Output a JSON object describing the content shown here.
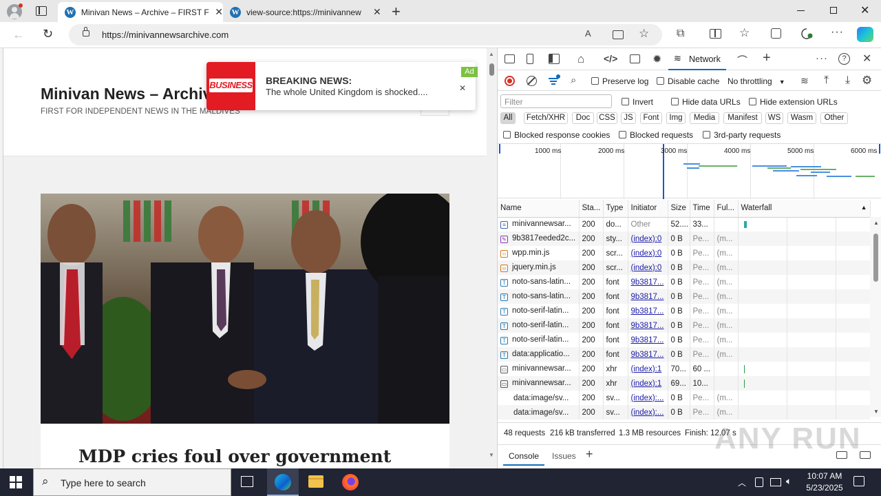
{
  "browser": {
    "tabs": [
      {
        "title": "Minivan News – Archive – FIRST F",
        "active": true
      },
      {
        "title": "view-source:https://minivannew",
        "active": false
      }
    ],
    "url": "https://minivannewsarchive.com"
  },
  "page": {
    "site_title": "Minivan News – Archiv",
    "tagline": "FIRST FOR INDEPENDENT NEWS IN THE MALDIVES",
    "headline": "MDP cries foul over government"
  },
  "notification": {
    "logo_text": "BUSINESS",
    "title": "BREAKING NEWS:",
    "body": "The whole United Kingdom is shocked....",
    "ad_label": "Ad"
  },
  "devtools": {
    "panel_tab": "Network",
    "preserve_log": "Preserve log",
    "disable_cache": "Disable cache",
    "throttling": "No throttling",
    "filter_placeholder": "Filter",
    "invert": "Invert",
    "hide_data_urls": "Hide data URLs",
    "hide_extension_urls": "Hide extension URLs",
    "type_filters": [
      "All",
      "Fetch/XHR",
      "Doc",
      "CSS",
      "JS",
      "Font",
      "Img",
      "Media",
      "Manifest",
      "WS",
      "Wasm",
      "Other"
    ],
    "blocked_response_cookies": "Blocked response cookies",
    "blocked_requests": "Blocked requests",
    "third_party": "3rd-party requests",
    "timeline_ticks": [
      "1000 ms",
      "2000 ms",
      "3000 ms",
      "4000 ms",
      "5000 ms",
      "6000 ms"
    ],
    "columns": [
      "Name",
      "Sta...",
      "Type",
      "Initiator",
      "Size",
      "Time",
      "Ful...",
      "Waterfall"
    ],
    "rows": [
      {
        "name": "minivannewsar...",
        "status": "200",
        "type": "do...",
        "initiator": "Other",
        "size": "52....",
        "time": "33...",
        "full": "",
        "icon": "doc"
      },
      {
        "name": "9b3817eeded2c...",
        "status": "200",
        "type": "sty...",
        "initiator": "(index):0",
        "size": "0 B",
        "time": "Pe...",
        "full": "(m...",
        "icon": "css"
      },
      {
        "name": "wpp.min.js",
        "status": "200",
        "type": "scr...",
        "initiator": "(index):0",
        "size": "0 B",
        "time": "Pe...",
        "full": "(m...",
        "icon": "js"
      },
      {
        "name": "jquery.min.js",
        "status": "200",
        "type": "scr...",
        "initiator": "(index):0",
        "size": "0 B",
        "time": "Pe...",
        "full": "(m...",
        "icon": "js"
      },
      {
        "name": "noto-sans-latin...",
        "status": "200",
        "type": "font",
        "initiator": "9b3817...",
        "size": "0 B",
        "time": "Pe...",
        "full": "(m...",
        "icon": "font"
      },
      {
        "name": "noto-sans-latin...",
        "status": "200",
        "type": "font",
        "initiator": "9b3817...",
        "size": "0 B",
        "time": "Pe...",
        "full": "(m...",
        "icon": "font"
      },
      {
        "name": "noto-serif-latin...",
        "status": "200",
        "type": "font",
        "initiator": "9b3817...",
        "size": "0 B",
        "time": "Pe...",
        "full": "(m...",
        "icon": "font"
      },
      {
        "name": "noto-serif-latin...",
        "status": "200",
        "type": "font",
        "initiator": "9b3817...",
        "size": "0 B",
        "time": "Pe...",
        "full": "(m...",
        "icon": "font"
      },
      {
        "name": "noto-serif-latin...",
        "status": "200",
        "type": "font",
        "initiator": "9b3817...",
        "size": "0 B",
        "time": "Pe...",
        "full": "(m...",
        "icon": "font"
      },
      {
        "name": "data:applicatio...",
        "status": "200",
        "type": "font",
        "initiator": "9b3817...",
        "size": "0 B",
        "time": "Pe...",
        "full": "(m...",
        "icon": "font"
      },
      {
        "name": "minivannewsar...",
        "status": "200",
        "type": "xhr",
        "initiator": "(index):1",
        "size": "70...",
        "time": "60 ...",
        "full": "",
        "icon": "xhr"
      },
      {
        "name": "minivannewsar...",
        "status": "200",
        "type": "xhr",
        "initiator": "(index):1",
        "size": "69...",
        "time": "10...",
        "full": "",
        "icon": "xhr"
      },
      {
        "name": "data:image/sv...",
        "status": "200",
        "type": "sv...",
        "initiator": "(index):...",
        "size": "0 B",
        "time": "Pe...",
        "full": "(m...",
        "icon": "none"
      },
      {
        "name": "data:image/sv...",
        "status": "200",
        "type": "sv...",
        "initiator": "(index):...",
        "size": "0 B",
        "time": "Pe...",
        "full": "(m...",
        "icon": "none"
      }
    ],
    "status_bar": {
      "requests": "48 requests",
      "transferred": "216 kB transferred",
      "resources": "1.3 MB resources",
      "finish": "Finish: 12.07 s"
    },
    "drawer_tabs": [
      "Console",
      "Issues"
    ]
  },
  "taskbar": {
    "search_placeholder": "Type here to search",
    "time": "10:07 AM",
    "date": "5/23/2025"
  },
  "watermark": "ANY RUN"
}
